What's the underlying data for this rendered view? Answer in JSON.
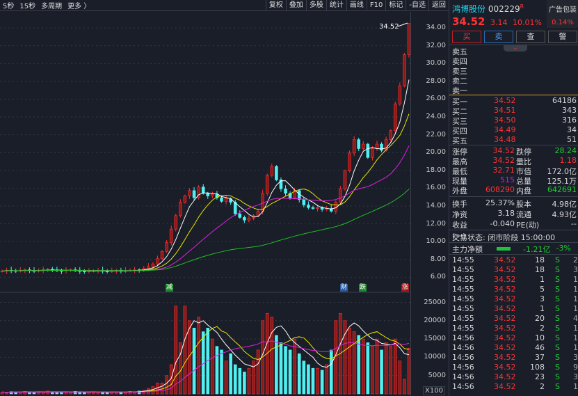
{
  "toolbar": {
    "left": [
      "5秒",
      "15秒",
      "多周期",
      "更多 〉"
    ],
    "right": [
      "复权",
      "叠加",
      "多股",
      "统计",
      "画线",
      "F10",
      "标记",
      "-自选",
      "返回"
    ]
  },
  "stock": {
    "name": "鸿博股份",
    "code": "002229",
    "badge": "R",
    "price": "34.52",
    "change": "3.14",
    "pct": "10.01%",
    "ad_label": "广告包装",
    "ad_pct": "0.14%"
  },
  "actions": [
    "买",
    "卖",
    "查",
    "警"
  ],
  "asks": [
    {
      "label": "卖五"
    },
    {
      "label": "卖四"
    },
    {
      "label": "卖三"
    },
    {
      "label": "卖二"
    },
    {
      "label": "卖一"
    }
  ],
  "bids": [
    {
      "label": "买一",
      "price": "34.52",
      "vol": "64186"
    },
    {
      "label": "买二",
      "price": "34.51",
      "vol": "343"
    },
    {
      "label": "买三",
      "price": "34.50",
      "vol": "316"
    },
    {
      "label": "买四",
      "price": "34.49",
      "vol": "34"
    },
    {
      "label": "买五",
      "price": "34.48",
      "vol": "51"
    }
  ],
  "stats": [
    {
      "k1": "涨停",
      "v1": "34.52",
      "k2": "跌停",
      "v2": "28.24",
      "c1": "red",
      "c2": "green"
    },
    {
      "k1": "最高",
      "v1": "34.52",
      "k2": "量比",
      "v2": "1.18",
      "c1": "red",
      "c2": "red"
    },
    {
      "k1": "最低",
      "v1": "32.71",
      "k2": "市值",
      "v2": "172.0亿",
      "c1": "red",
      "c2": ""
    },
    {
      "k1": "现量",
      "v1": "515",
      "k2": "总量",
      "v2": "125.1万",
      "c1": "purple",
      "c2": ""
    },
    {
      "k1": "外盘",
      "v1": "608290",
      "k2": "内盘",
      "v2": "642691",
      "c1": "red",
      "c2": "green"
    }
  ],
  "stats2": [
    {
      "k1": "换手",
      "v1": "25.37%",
      "k2": "股本",
      "v2": "4.98亿"
    },
    {
      "k1": "净资",
      "v1": "3.18",
      "k2": "流通",
      "v2": "4.93亿"
    },
    {
      "k1": "收益(一)",
      "v1": "-0.040",
      "k2": "PE(动)",
      "v2": "--"
    }
  ],
  "status": "交易状态: 闭市阶段 15:00:00",
  "mainflow": {
    "label": "主力净额",
    "value": "-1.21亿",
    "pct": "-3%"
  },
  "trades": [
    [
      "14:55",
      "34.52",
      "18",
      "S",
      "2"
    ],
    [
      "14:55",
      "34.52",
      "18",
      "S",
      "3"
    ],
    [
      "14:55",
      "34.52",
      "1",
      "S",
      "1"
    ],
    [
      "14:55",
      "34.52",
      "5",
      "S",
      "1"
    ],
    [
      "14:55",
      "34.52",
      "3",
      "S",
      "1"
    ],
    [
      "14:55",
      "34.52",
      "1",
      "S",
      "1"
    ],
    [
      "14:55",
      "34.52",
      "20",
      "S",
      "4"
    ],
    [
      "14:55",
      "34.52",
      "2",
      "S",
      "1"
    ],
    [
      "14:56",
      "34.52",
      "10",
      "S",
      "1"
    ],
    [
      "14:56",
      "34.52",
      "46",
      "S",
      "1"
    ],
    [
      "14:56",
      "34.52",
      "37",
      "S",
      "3"
    ],
    [
      "14:56",
      "34.52",
      "108",
      "S",
      "9"
    ],
    [
      "14:56",
      "34.52",
      "23",
      "S",
      "3"
    ],
    [
      "14:56",
      "34.52",
      "2",
      "S",
      "1"
    ]
  ],
  "chart_data": {
    "type": "candlestick",
    "price_ticks": [
      "34.00",
      "32.00",
      "30.00",
      "28.00",
      "26.00",
      "24.00",
      "22.00",
      "20.00",
      "18.00",
      "16.00",
      "14.00",
      "12.00",
      "10.00",
      "8.00",
      "6.00"
    ],
    "volume_ticks": [
      "25000",
      "20000",
      "15000",
      "10000",
      "5000"
    ],
    "volume_unit": "X100",
    "last_label": "34.52",
    "markers": [
      {
        "t": "减",
        "c": "#1a8a2a"
      },
      {
        "t": "财",
        "c": "#2a5aa0"
      },
      {
        "t": "跌",
        "c": "#1a8a2a"
      },
      {
        "t": "涨",
        "c": "#a01a1a"
      }
    ],
    "closes": [
      6.8,
      6.9,
      6.85,
      6.8,
      6.9,
      6.95,
      6.85,
      6.8,
      6.9,
      6.95,
      7.0,
      6.9,
      6.85,
      6.8,
      6.9,
      6.95,
      6.85,
      6.8,
      6.75,
      6.8,
      6.85,
      6.9,
      6.8,
      6.75,
      6.85,
      6.9,
      6.8,
      6.85,
      6.9,
      6.95,
      6.9,
      7.1,
      7.3,
      7.6,
      8.2,
      9.0,
      10.0,
      11.5,
      13.0,
      14.5,
      15.2,
      15.8,
      15.0,
      16.2,
      15.5,
      15.2,
      15.4,
      15.0,
      14.6,
      14.9,
      14.5,
      13.2,
      12.8,
      12.5,
      12.7,
      13.0,
      13.5,
      15.5,
      17.5,
      18.5,
      17.0,
      16.0,
      15.5,
      15.0,
      15.8,
      14.8,
      14.2,
      13.9,
      13.8,
      13.9,
      13.7,
      13.8,
      13.5,
      14.5,
      16.0,
      18.0,
      20.0,
      21.5,
      20.5,
      21.0,
      19.5,
      20.5,
      21.0,
      20.3,
      21.5,
      22.5,
      25.5,
      27.5,
      31.0,
      34.52
    ],
    "volumes": [
      500,
      400,
      600,
      450,
      500,
      700,
      400,
      500,
      600,
      450,
      800,
      500,
      400,
      600,
      500,
      450,
      700,
      500,
      400,
      500,
      600,
      450,
      500,
      400,
      600,
      500,
      450,
      500,
      700,
      600,
      800,
      1000,
      1500,
      2000,
      3000,
      3000,
      5000,
      8000,
      24000,
      14000,
      24000,
      20000,
      18000,
      21000,
      17000,
      18000,
      15000,
      13000,
      12000,
      9000,
      11000,
      8000,
      7000,
      6000,
      7000,
      9000,
      12000,
      20000,
      22000,
      21000,
      16000,
      14000,
      13000,
      12000,
      15000,
      11000,
      9000,
      8000,
      7000,
      7000,
      6500,
      8000,
      12000,
      20000,
      22000,
      20000,
      18000,
      17000,
      16000,
      15000,
      14000,
      13000,
      15000,
      12000,
      14000,
      13000,
      15000,
      9000,
      4000,
      12500
    ],
    "ma_colors": [
      "#ffffff",
      "#e8e800",
      "#e020e0",
      "#20c020"
    ]
  }
}
